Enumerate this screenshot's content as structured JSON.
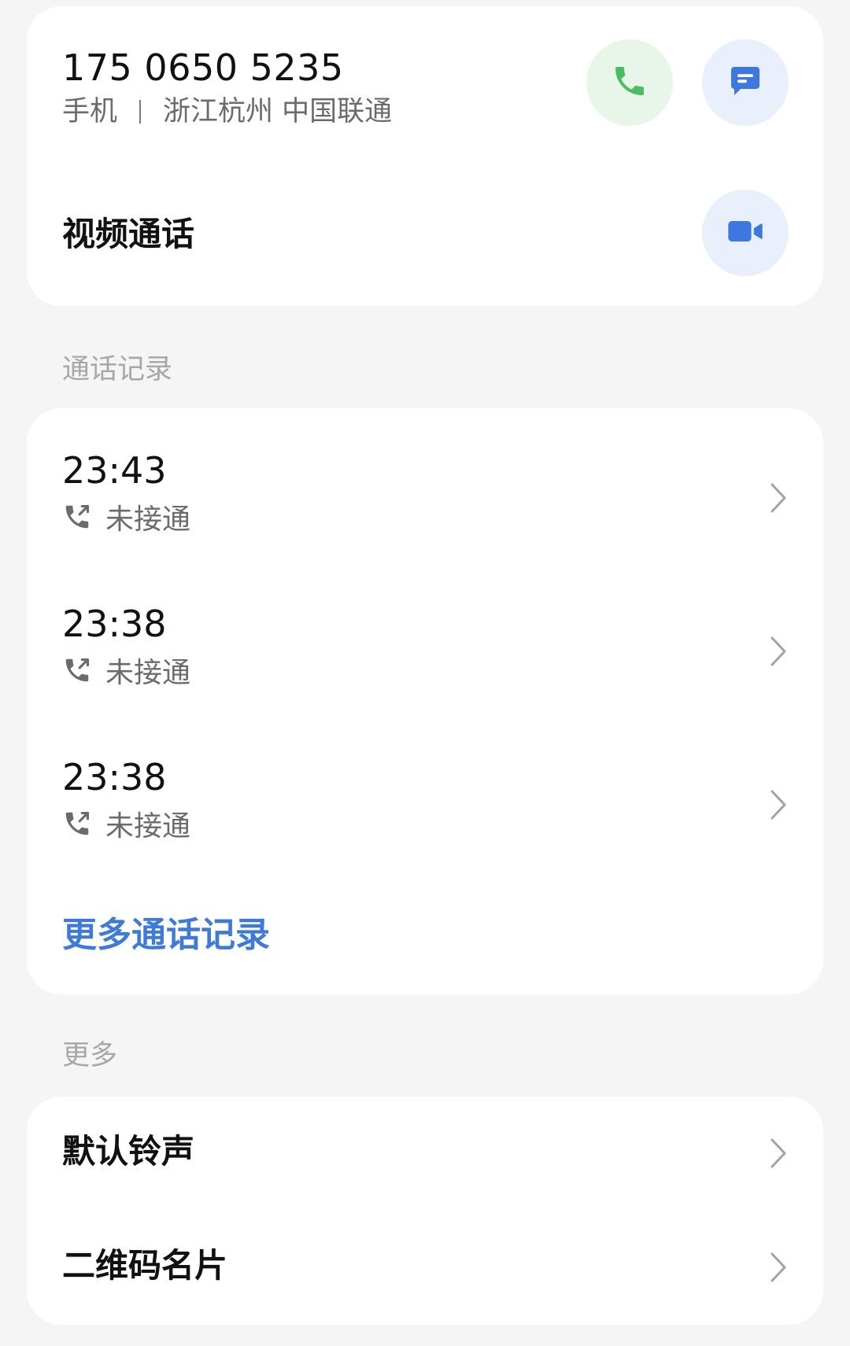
{
  "contact": {
    "phone_number": "175 0650 5235",
    "phone_type": "手机",
    "location_carrier": "浙江杭州 中国联通",
    "video_call_label": "视频通话",
    "call_icon": "phone-icon",
    "message_icon": "message-icon",
    "video_icon": "video-camera-icon",
    "colors": {
      "call_accent": "#4cbc63",
      "call_bg": "#e8f6ea",
      "message_accent": "#3d78e0",
      "message_bg": "#e9effb"
    }
  },
  "call_history": {
    "section_label": "通话记录",
    "entries": [
      {
        "time": "23:43",
        "status": "未接通",
        "status_icon": "outgoing-call-icon"
      },
      {
        "time": "23:38",
        "status": "未接通",
        "status_icon": "outgoing-call-icon"
      },
      {
        "time": "23:38",
        "status": "未接通",
        "status_icon": "outgoing-call-icon"
      }
    ],
    "more_link": "更多通话记录",
    "link_color": "#3f7ad9"
  },
  "more": {
    "section_label": "更多",
    "items": [
      {
        "label": "默认铃声"
      },
      {
        "label": "二维码名片"
      }
    ]
  }
}
